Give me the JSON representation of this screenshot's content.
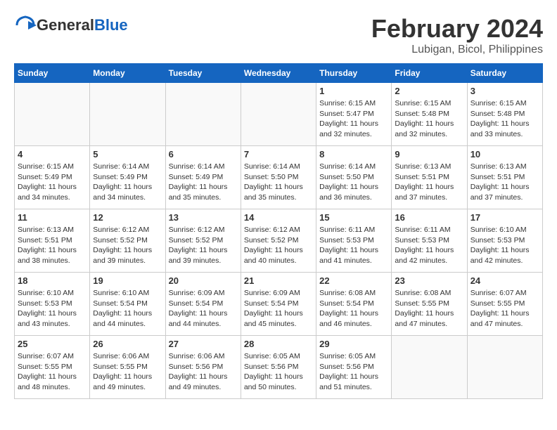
{
  "header": {
    "logo_general": "General",
    "logo_blue": "Blue",
    "month_year": "February 2024",
    "location": "Lubigan, Bicol, Philippines"
  },
  "weekdays": [
    "Sunday",
    "Monday",
    "Tuesday",
    "Wednesday",
    "Thursday",
    "Friday",
    "Saturday"
  ],
  "weeks": [
    [
      {
        "day": "",
        "info": ""
      },
      {
        "day": "",
        "info": ""
      },
      {
        "day": "",
        "info": ""
      },
      {
        "day": "",
        "info": ""
      },
      {
        "day": "1",
        "info": "Sunrise: 6:15 AM\nSunset: 5:47 PM\nDaylight: 11 hours\nand 32 minutes."
      },
      {
        "day": "2",
        "info": "Sunrise: 6:15 AM\nSunset: 5:48 PM\nDaylight: 11 hours\nand 32 minutes."
      },
      {
        "day": "3",
        "info": "Sunrise: 6:15 AM\nSunset: 5:48 PM\nDaylight: 11 hours\nand 33 minutes."
      }
    ],
    [
      {
        "day": "4",
        "info": "Sunrise: 6:15 AM\nSunset: 5:49 PM\nDaylight: 11 hours\nand 34 minutes."
      },
      {
        "day": "5",
        "info": "Sunrise: 6:14 AM\nSunset: 5:49 PM\nDaylight: 11 hours\nand 34 minutes."
      },
      {
        "day": "6",
        "info": "Sunrise: 6:14 AM\nSunset: 5:49 PM\nDaylight: 11 hours\nand 35 minutes."
      },
      {
        "day": "7",
        "info": "Sunrise: 6:14 AM\nSunset: 5:50 PM\nDaylight: 11 hours\nand 35 minutes."
      },
      {
        "day": "8",
        "info": "Sunrise: 6:14 AM\nSunset: 5:50 PM\nDaylight: 11 hours\nand 36 minutes."
      },
      {
        "day": "9",
        "info": "Sunrise: 6:13 AM\nSunset: 5:51 PM\nDaylight: 11 hours\nand 37 minutes."
      },
      {
        "day": "10",
        "info": "Sunrise: 6:13 AM\nSunset: 5:51 PM\nDaylight: 11 hours\nand 37 minutes."
      }
    ],
    [
      {
        "day": "11",
        "info": "Sunrise: 6:13 AM\nSunset: 5:51 PM\nDaylight: 11 hours\nand 38 minutes."
      },
      {
        "day": "12",
        "info": "Sunrise: 6:12 AM\nSunset: 5:52 PM\nDaylight: 11 hours\nand 39 minutes."
      },
      {
        "day": "13",
        "info": "Sunrise: 6:12 AM\nSunset: 5:52 PM\nDaylight: 11 hours\nand 39 minutes."
      },
      {
        "day": "14",
        "info": "Sunrise: 6:12 AM\nSunset: 5:52 PM\nDaylight: 11 hours\nand 40 minutes."
      },
      {
        "day": "15",
        "info": "Sunrise: 6:11 AM\nSunset: 5:53 PM\nDaylight: 11 hours\nand 41 minutes."
      },
      {
        "day": "16",
        "info": "Sunrise: 6:11 AM\nSunset: 5:53 PM\nDaylight: 11 hours\nand 42 minutes."
      },
      {
        "day": "17",
        "info": "Sunrise: 6:10 AM\nSunset: 5:53 PM\nDaylight: 11 hours\nand 42 minutes."
      }
    ],
    [
      {
        "day": "18",
        "info": "Sunrise: 6:10 AM\nSunset: 5:53 PM\nDaylight: 11 hours\nand 43 minutes."
      },
      {
        "day": "19",
        "info": "Sunrise: 6:10 AM\nSunset: 5:54 PM\nDaylight: 11 hours\nand 44 minutes."
      },
      {
        "day": "20",
        "info": "Sunrise: 6:09 AM\nSunset: 5:54 PM\nDaylight: 11 hours\nand 44 minutes."
      },
      {
        "day": "21",
        "info": "Sunrise: 6:09 AM\nSunset: 5:54 PM\nDaylight: 11 hours\nand 45 minutes."
      },
      {
        "day": "22",
        "info": "Sunrise: 6:08 AM\nSunset: 5:54 PM\nDaylight: 11 hours\nand 46 minutes."
      },
      {
        "day": "23",
        "info": "Sunrise: 6:08 AM\nSunset: 5:55 PM\nDaylight: 11 hours\nand 47 minutes."
      },
      {
        "day": "24",
        "info": "Sunrise: 6:07 AM\nSunset: 5:55 PM\nDaylight: 11 hours\nand 47 minutes."
      }
    ],
    [
      {
        "day": "25",
        "info": "Sunrise: 6:07 AM\nSunset: 5:55 PM\nDaylight: 11 hours\nand 48 minutes."
      },
      {
        "day": "26",
        "info": "Sunrise: 6:06 AM\nSunset: 5:55 PM\nDaylight: 11 hours\nand 49 minutes."
      },
      {
        "day": "27",
        "info": "Sunrise: 6:06 AM\nSunset: 5:56 PM\nDaylight: 11 hours\nand 49 minutes."
      },
      {
        "day": "28",
        "info": "Sunrise: 6:05 AM\nSunset: 5:56 PM\nDaylight: 11 hours\nand 50 minutes."
      },
      {
        "day": "29",
        "info": "Sunrise: 6:05 AM\nSunset: 5:56 PM\nDaylight: 11 hours\nand 51 minutes."
      },
      {
        "day": "",
        "info": ""
      },
      {
        "day": "",
        "info": ""
      }
    ]
  ]
}
